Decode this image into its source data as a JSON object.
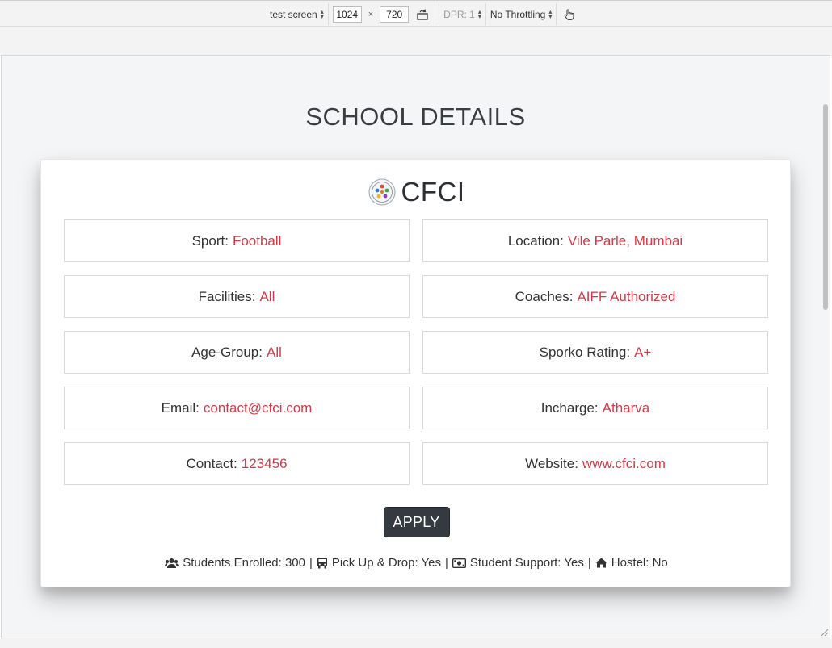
{
  "devtools": {
    "device": "test screen",
    "width": "1024",
    "times": "×",
    "height": "720",
    "dpr": "DPR: 1",
    "throttling": "No Throttling"
  },
  "page": {
    "title": "SCHOOL DETAILS"
  },
  "school": {
    "name": "CFCI",
    "logo_icon": "school-crest-icon"
  },
  "details": [
    {
      "label": "Sport:",
      "value": "Football"
    },
    {
      "label": "Location:",
      "value": "Vile Parle, Mumbai"
    },
    {
      "label": "Facilities:",
      "value": "All"
    },
    {
      "label": "Coaches:",
      "value": "AIFF Authorized"
    },
    {
      "label": "Age-Group:",
      "value": "All"
    },
    {
      "label": "Sporko Rating:",
      "value": "A+"
    },
    {
      "label": "Email:",
      "value": "contact@cfci.com"
    },
    {
      "label": "Incharge:",
      "value": "Atharva"
    },
    {
      "label": "Contact:",
      "value": "123456"
    },
    {
      "label": "Website:",
      "value": "www.cfci.com"
    }
  ],
  "apply_label": "APPLY",
  "stats": {
    "students": "Students Enrolled: 300",
    "pickup": "Pick Up & Drop: Yes",
    "support": "Student Support: Yes",
    "hostel": "Hostel: No",
    "separator": "|"
  },
  "colors": {
    "accent": "#d63947",
    "button": "#343a40"
  }
}
